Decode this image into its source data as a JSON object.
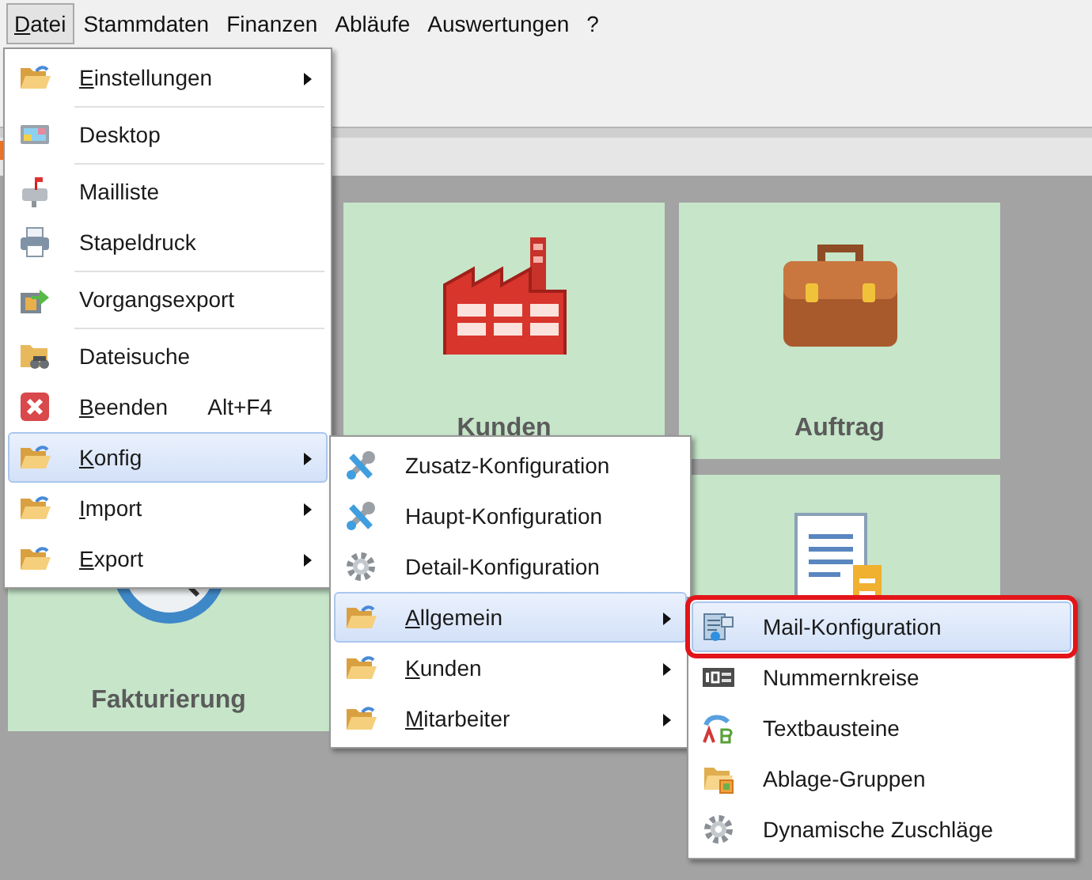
{
  "menubar": [
    {
      "label": "Datei",
      "selected": true,
      "underline_first": true
    },
    {
      "label": "Stammdaten",
      "selected": false,
      "underline_first": false
    },
    {
      "label": "Finanzen",
      "selected": false,
      "underline_first": false
    },
    {
      "label": "Abläufe",
      "selected": false,
      "underline_first": false
    },
    {
      "label": "Auswertungen",
      "selected": false,
      "underline_first": false
    },
    {
      "label": "?",
      "selected": false,
      "underline_first": false
    }
  ],
  "tiles": [
    {
      "kind": "tile",
      "label": "Kunden"
    },
    {
      "kind": "tile",
      "label": "Auftrag"
    },
    {
      "kind": "tile",
      "label": "Fakturierung"
    },
    {
      "kind": "tile"
    }
  ],
  "menus": [
    {
      "items": [
        {
          "kind": "item",
          "label": "Einstellungen",
          "underline_first": true,
          "submenu": true,
          "selected": false
        },
        {
          "kind": "separator"
        },
        {
          "kind": "item",
          "label": "Desktop",
          "underline_first": false,
          "submenu": false,
          "selected": false
        },
        {
          "kind": "separator"
        },
        {
          "kind": "item",
          "label": "Mailliste",
          "underline_first": false,
          "submenu": false,
          "selected": false
        },
        {
          "kind": "item",
          "label": "Stapeldruck",
          "underline_first": false,
          "submenu": false,
          "selected": false
        },
        {
          "kind": "separator"
        },
        {
          "kind": "item",
          "label": "Vorgangsexport",
          "underline_first": false,
          "submenu": false,
          "selected": false
        },
        {
          "kind": "separator"
        },
        {
          "kind": "item",
          "label": "Dateisuche",
          "underline_first": false,
          "submenu": false,
          "selected": false
        },
        {
          "kind": "item",
          "label": "Beenden",
          "shortcut": "Alt+F4",
          "underline_first": true,
          "submenu": false,
          "selected": false
        },
        {
          "kind": "item",
          "label": "Konfig",
          "underline_first": true,
          "submenu": true,
          "selected": true
        },
        {
          "kind": "item",
          "label": "Import",
          "underline_first": true,
          "submenu": true,
          "selected": false
        },
        {
          "kind": "item",
          "label": "Export",
          "underline_first": true,
          "submenu": true,
          "selected": false
        }
      ]
    },
    {
      "items": [
        {
          "kind": "item",
          "label": "Zusatz-Konfiguration",
          "underline_first": false,
          "submenu": false,
          "selected": false
        },
        {
          "kind": "item",
          "label": "Haupt-Konfiguration",
          "underline_first": false,
          "submenu": false,
          "selected": false
        },
        {
          "kind": "item",
          "label": "Detail-Konfiguration",
          "underline_first": false,
          "submenu": false,
          "selected": false
        },
        {
          "kind": "item",
          "label": "Allgemein",
          "underline_first": true,
          "submenu": true,
          "selected": true
        },
        {
          "kind": "item",
          "label": "Kunden",
          "underline_first": true,
          "submenu": true,
          "selected": false
        },
        {
          "kind": "item",
          "label": "Mitarbeiter",
          "underline_first": true,
          "submenu": true,
          "selected": false
        }
      ]
    },
    {
      "items": [
        {
          "kind": "item",
          "label": "Mail-Konfiguration",
          "underline_first": false,
          "submenu": false,
          "selected": true,
          "outlined": true
        },
        {
          "kind": "item",
          "label": "Nummernkreise",
          "underline_first": false,
          "submenu": false,
          "selected": false,
          "outlined": false
        },
        {
          "kind": "item",
          "label": "Textbausteine",
          "underline_first": false,
          "submenu": false,
          "selected": false,
          "outlined": false
        },
        {
          "kind": "item",
          "label": "Ablage-Gruppen",
          "underline_first": false,
          "submenu": false,
          "selected": false,
          "outlined": false
        },
        {
          "kind": "item",
          "label": "Dynamische Zuschläge",
          "underline_first": false,
          "submenu": false,
          "selected": false,
          "outlined": false
        }
      ]
    }
  ]
}
